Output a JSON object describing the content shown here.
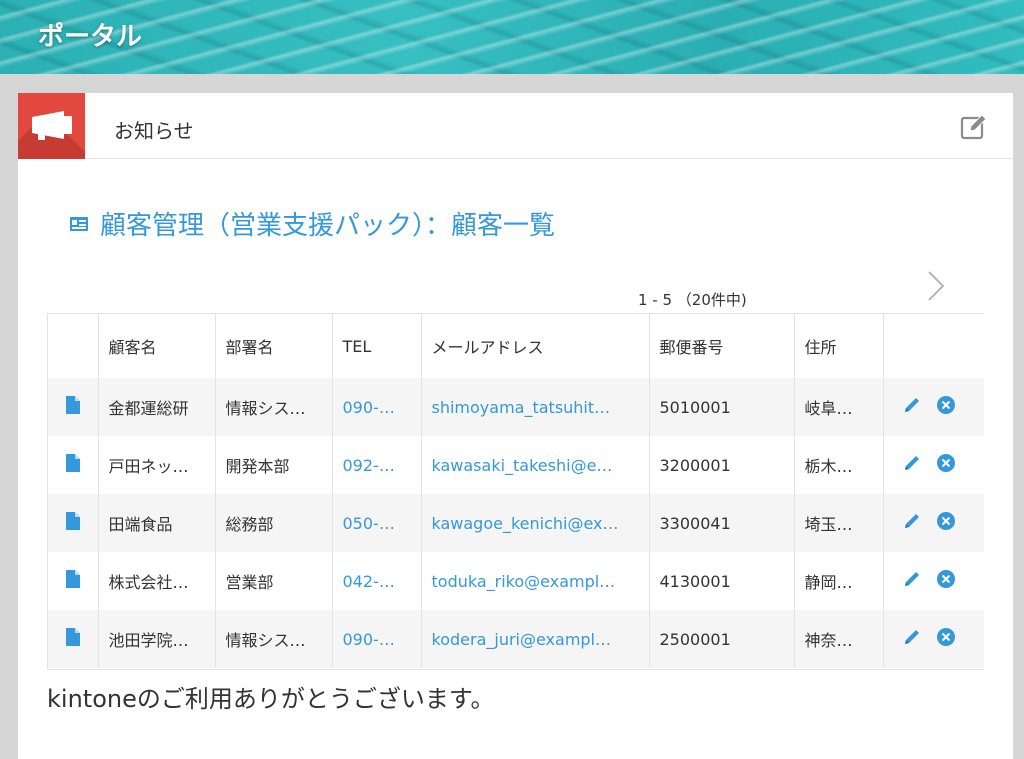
{
  "header": {
    "title": "ポータル"
  },
  "notice": {
    "title": "お知らせ",
    "list_title": "顧客管理（営業支援パック）：顧客一覧",
    "pager": "1 - 5 （20件中)",
    "footer": "kintoneのご利用ありがとうございます。"
  },
  "table": {
    "columns": [
      "顧客名",
      "部署名",
      "TEL",
      "メールアドレス",
      "郵便番号",
      "住所"
    ],
    "rows": [
      {
        "name": "金都運総研",
        "dept": "情報シス…",
        "tel": "090-…",
        "email": "shimoyama_tatsuhit…",
        "zip": "5010001",
        "addr": "岐阜…"
      },
      {
        "name": "戸田ネッ…",
        "dept": "開発本部",
        "tel": "092-…",
        "email": "kawasaki_takeshi@e…",
        "zip": "3200001",
        "addr": "栃木…"
      },
      {
        "name": "田端食品",
        "dept": "総務部",
        "tel": "050-…",
        "email": "kawagoe_kenichi@ex…",
        "zip": "3300041",
        "addr": "埼玉…"
      },
      {
        "name": "株式会社…",
        "dept": "営業部",
        "tel": "042-…",
        "email": "toduka_riko@exampl…",
        "zip": "4130001",
        "addr": "静岡…"
      },
      {
        "name": "池田学院…",
        "dept": "情報シス…",
        "tel": "090-…",
        "email": "kodera_juri@exampl…",
        "zip": "2500001",
        "addr": "神奈…"
      }
    ]
  },
  "colors": {
    "accent": "#3498db",
    "notice_red": "#e2483e"
  }
}
